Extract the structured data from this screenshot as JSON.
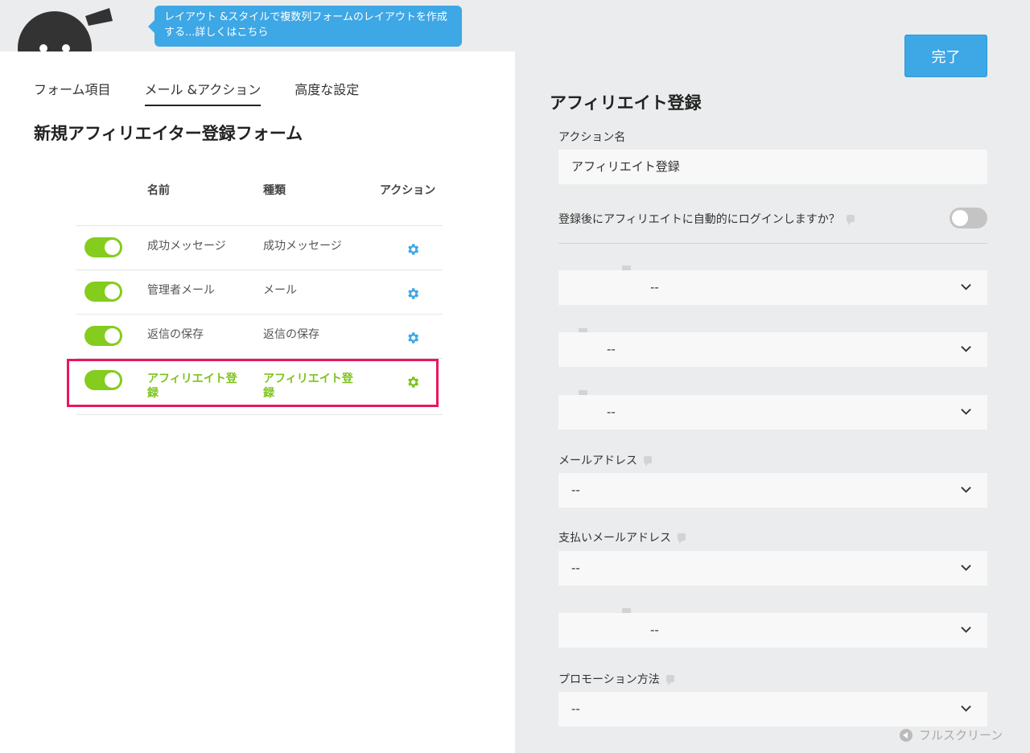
{
  "tooltip": {
    "text": "レイアウト &スタイルで複数列フォームのレイアウトを作成する...詳しくはこちら"
  },
  "tabs": [
    {
      "label": "フォーム項目"
    },
    {
      "label": "メール &アクション"
    },
    {
      "label": "高度な設定"
    }
  ],
  "form": {
    "title": "新規アフィリエイター登録フォーム"
  },
  "table": {
    "headers": {
      "name": "名前",
      "type": "種類",
      "action": "アクション"
    },
    "rows": [
      {
        "name": "成功メッセージ",
        "type": "成功メッセージ",
        "enabled": true
      },
      {
        "name": "管理者メール",
        "type": "メール",
        "enabled": true
      },
      {
        "name": "返信の保存",
        "type": "返信の保存",
        "enabled": true
      },
      {
        "name": "アフィリエイト登録",
        "type": "アフィリエイト登録",
        "enabled": true
      }
    ]
  },
  "right": {
    "done_label": "完了",
    "title": "アフィリエイト登録",
    "action_name_label": "アクション名",
    "action_name_value": "アフィリエイト登録",
    "auto_login_label": "登録後にアフィリエイトに自動的にログインしますか？",
    "auto_login_enabled": false,
    "selects": [
      {
        "label": "",
        "value": "--"
      },
      {
        "label": "",
        "value": "--"
      },
      {
        "label": "",
        "value": "--"
      },
      {
        "label": "メールアドレス",
        "value": "--"
      },
      {
        "label": "支払いメールアドレス",
        "value": "--"
      },
      {
        "label": "",
        "value": "--"
      },
      {
        "label": "プロモーション方法",
        "value": "--"
      }
    ]
  },
  "footer": {
    "fullscreen_label": "フルスクリーン"
  },
  "colors": {
    "accent_blue": "#3ea7e5",
    "toggle_green": "#84cc1e",
    "highlight": "#ea1660"
  }
}
